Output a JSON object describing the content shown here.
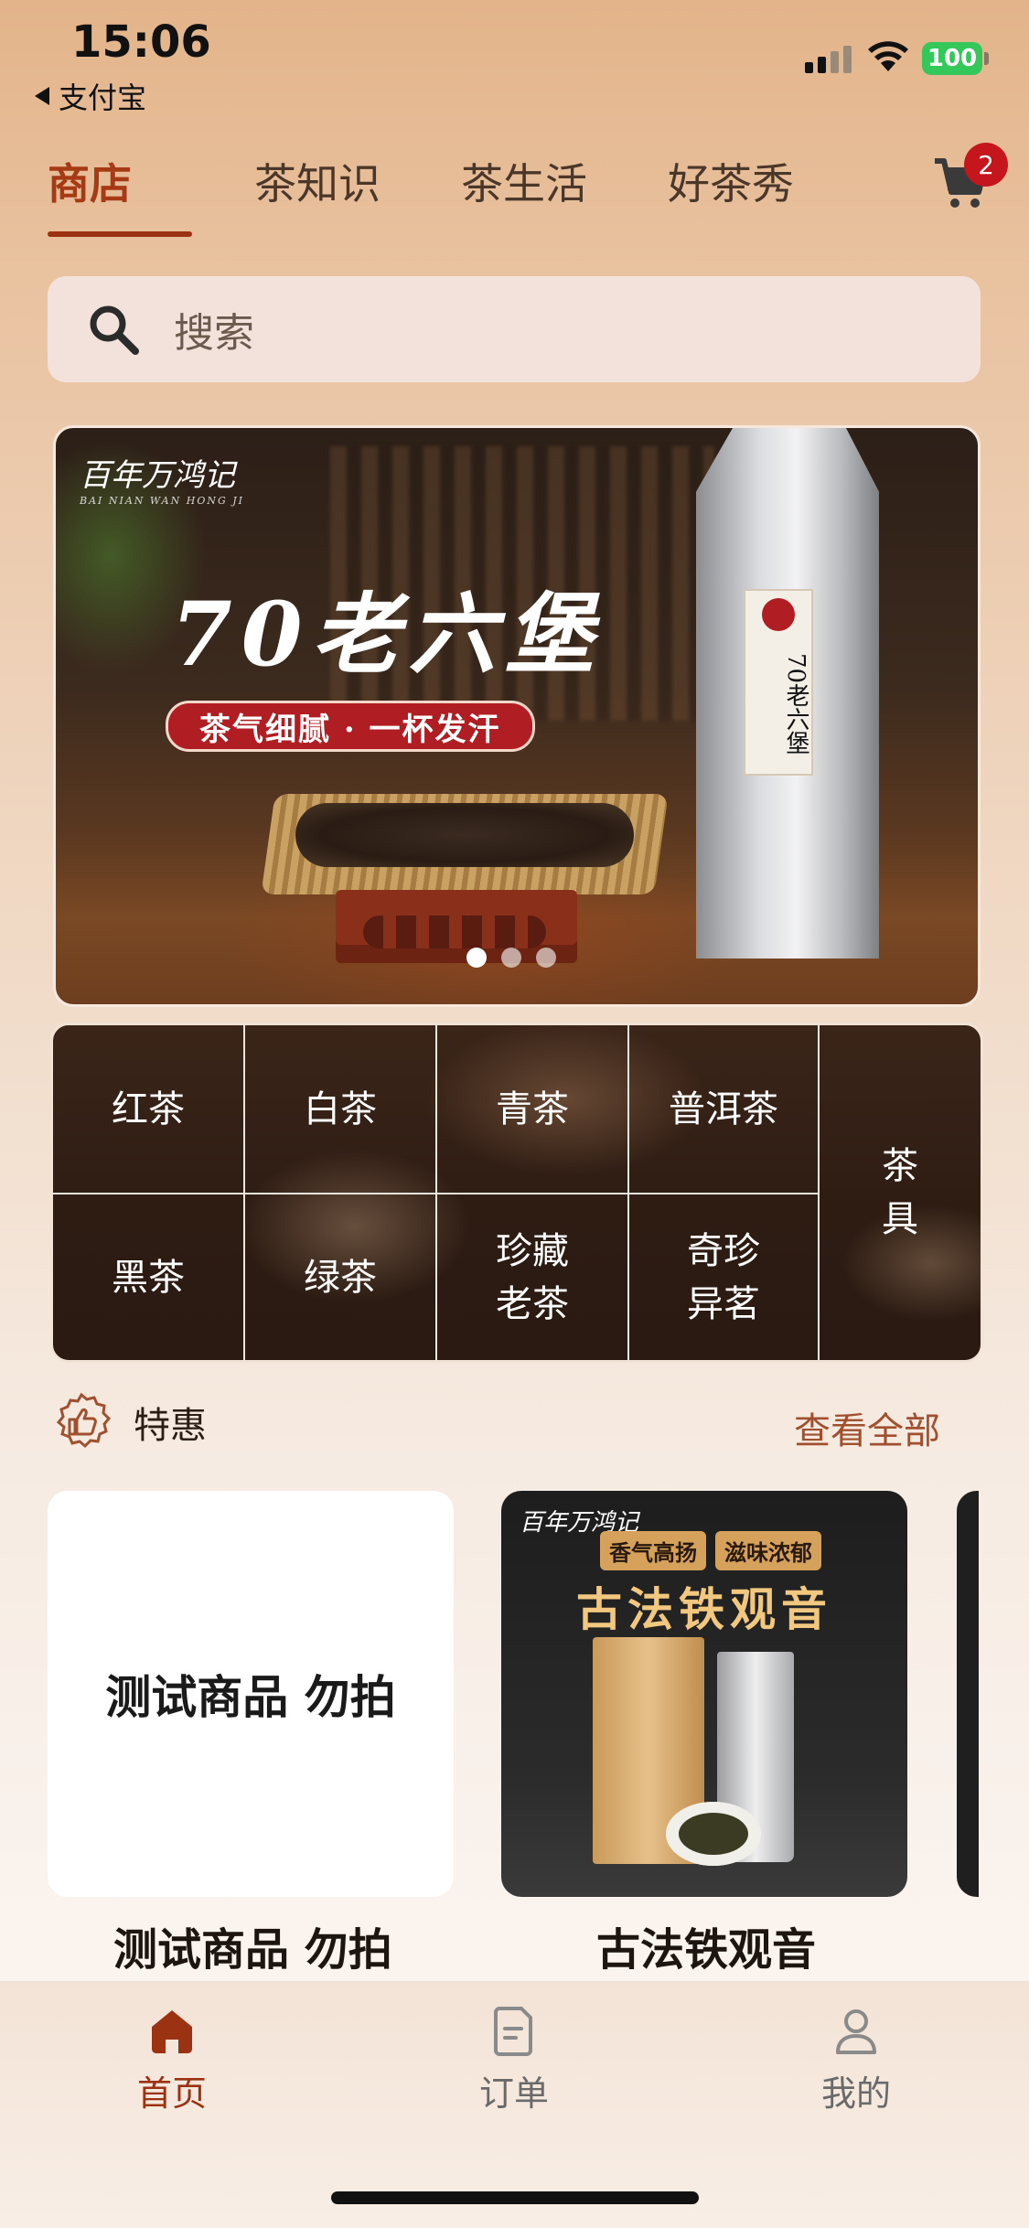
{
  "status_bar": {
    "time": "15:06",
    "back_app": "支付宝",
    "battery": "100"
  },
  "top_tabs": [
    {
      "label": "商店",
      "active": true
    },
    {
      "label": "茶知识",
      "active": false
    },
    {
      "label": "茶生活",
      "active": false
    },
    {
      "label": "好茶秀",
      "active": false
    }
  ],
  "cart": {
    "badge_count": "2"
  },
  "search": {
    "placeholder": "搜索"
  },
  "banner": {
    "brand": "百年万鸿记",
    "brand_sub": "BAI NIAN WAN HONG JI",
    "title": "70老六堡",
    "slogan": "茶气细腻 · 一杯发汗",
    "package_label": "70老六堡",
    "slides": 3,
    "active_slide": 1
  },
  "categories": {
    "row1": [
      "红茶",
      "白茶",
      "青茶",
      "普洱茶"
    ],
    "row2": [
      "黑茶",
      "绿茶",
      "珍藏\n老茶",
      "奇珍\n异茗"
    ],
    "side": "茶\n具"
  },
  "special": {
    "title": "特惠",
    "see_all": "查看全部"
  },
  "products": [
    {
      "image_text": "测试商品 勿拍",
      "name": "测试商品 勿拍"
    },
    {
      "brand": "百年万鸿记",
      "tags": [
        "香气高扬",
        "滋味浓郁"
      ],
      "image_title": "古法铁观音",
      "name": "古法铁观音"
    }
  ],
  "bottom_nav": [
    {
      "label": "首页",
      "icon": "home-icon",
      "active": true
    },
    {
      "label": "订单",
      "icon": "document-icon",
      "active": false
    },
    {
      "label": "我的",
      "icon": "user-icon",
      "active": false
    }
  ],
  "colors": {
    "accent": "#9b3312",
    "badge": "#c4161c",
    "battery": "#34c759"
  }
}
